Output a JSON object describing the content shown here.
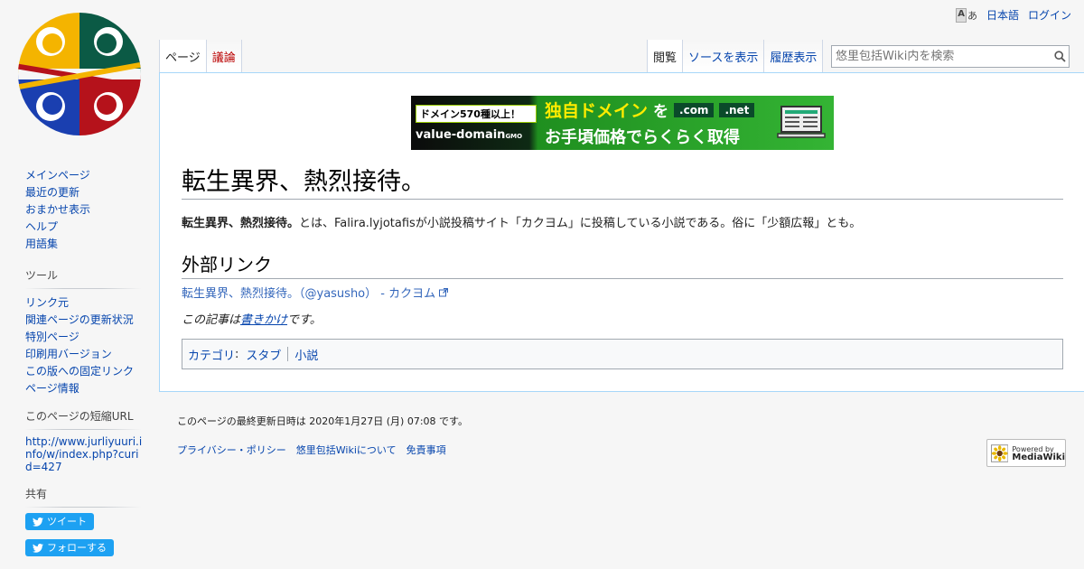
{
  "personal": {
    "language": "日本語",
    "login": "ログイン",
    "lang_icon_a": "A",
    "lang_icon_b": "あ"
  },
  "tabs_left": [
    {
      "label": "ページ"
    },
    {
      "label": "議論"
    }
  ],
  "tabs_right": [
    {
      "label": "閲覧"
    },
    {
      "label": "ソースを表示"
    },
    {
      "label": "履歴表示"
    }
  ],
  "search": {
    "placeholder": "悠里包括Wiki内を検索"
  },
  "banner": {
    "tag": "ドメイン570種以上！",
    "brand": "value-domain",
    "brand_suffix": "GMO",
    "title": "独自ドメイン",
    "wo": "を",
    "tld1": ".com",
    "tld2": ".net",
    "subtitle": "お手頃価格でらくらく取得"
  },
  "page": {
    "title": "転生異界、熱烈接待。",
    "lead_bold": "転生異界、熱烈接待。",
    "lead_rest": "とは、Falira.lyjotafisが小説投稿サイト「カクヨム」に投稿している小説である。俗に「少額広報」とも。",
    "section_external": "外部リンク",
    "external_link": "転生異界、熱烈接待。（@yasusho） - カクヨム",
    "stub_prefix": "この記事は",
    "stub_link": "書きかけ",
    "stub_suffix": "です。",
    "categories_label": "カテゴリ",
    "categories": [
      "スタブ",
      "小説"
    ]
  },
  "sidebar": {
    "nav": [
      "メインページ",
      "最近の更新",
      "おまかせ表示",
      "ヘルプ",
      "用語集"
    ],
    "tools_heading": "ツール",
    "tools": [
      "リンク元",
      "関連ページの更新状況",
      "特別ページ",
      "印刷用バージョン",
      "この版への固定リンク",
      "ページ情報"
    ],
    "shorturl_heading": "このページの短縮URL",
    "shorturl": "http://www.jurliyuuri.info/w/index.php?curid=427",
    "share_heading": "共有",
    "tweet": "ツイート",
    "follow": "フォローする"
  },
  "footer": {
    "lastmod": "このページの最終更新日時は 2020年1月27日 (月) 07:08 です。",
    "links": [
      "プライバシー・ポリシー",
      "悠里包括Wikiについて",
      "免責事項"
    ],
    "powered_top": "Powered by",
    "powered_name": "MediaWiki"
  },
  "colors": {
    "link": "#0645ad",
    "new_link": "#ba0000",
    "twitter": "#1da1f2",
    "border": "#a7d7f9"
  },
  "icons": {
    "search": "search-icon",
    "external": "external-link-icon",
    "twitter": "twitter-bird-icon"
  }
}
